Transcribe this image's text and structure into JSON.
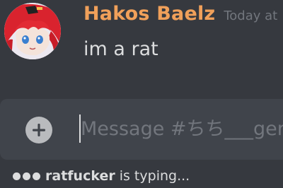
{
  "message": {
    "author": "Hakos Baelz",
    "timestamp": "Today at",
    "text": "im a rat",
    "author_color": "#f0a05a"
  },
  "composer": {
    "placeholder": "Message #ちち___gen",
    "attach_icon": "plus-circle-icon"
  },
  "typing": {
    "user": "ratfucker",
    "suffix": "is typing..."
  },
  "theme": {
    "background": "#36393f",
    "input_background": "#40444b",
    "text": "#dcddde",
    "muted": "#72767d"
  }
}
